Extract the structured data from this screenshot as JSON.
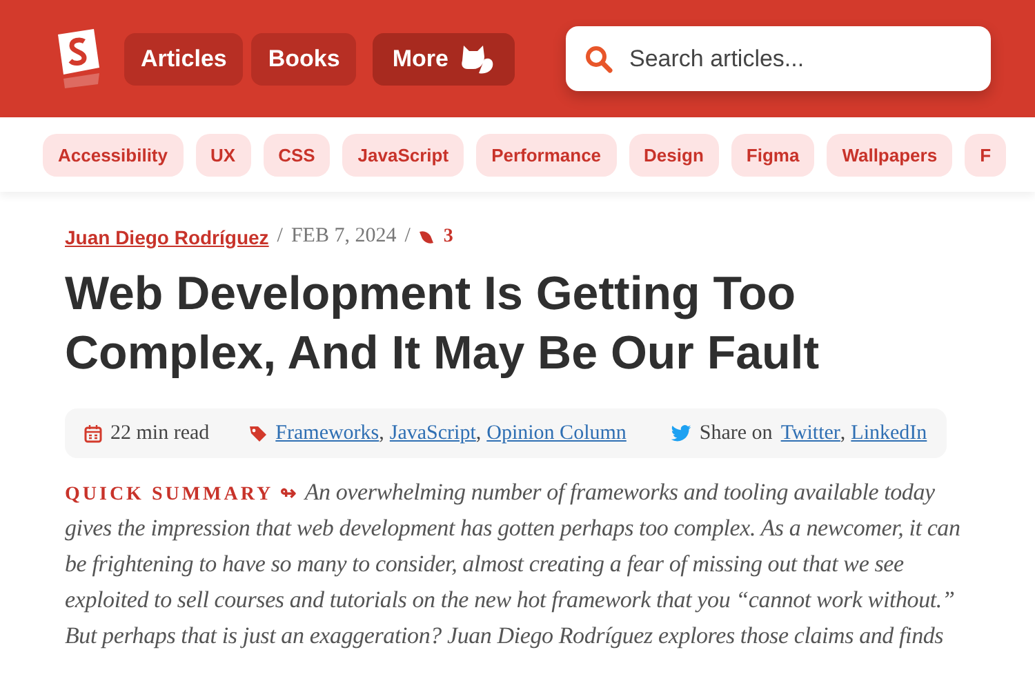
{
  "header": {
    "nav": [
      {
        "label": "Articles",
        "kind": "plain"
      },
      {
        "label": "Books",
        "kind": "plain"
      },
      {
        "label": "More",
        "kind": "mascot"
      }
    ],
    "search": {
      "placeholder": "Search articles..."
    }
  },
  "topics": [
    "Accessibility",
    "UX",
    "CSS",
    "JavaScript",
    "Performance",
    "Design",
    "Figma",
    "Wallpapers",
    "F"
  ],
  "meta": {
    "author": "Juan Diego Rodríguez",
    "separator": "/",
    "date": "FEB 7, 2024",
    "separator_2": "/",
    "comments": "3"
  },
  "title": "Web Development Is Getting Too Complex, And It May Be Our Fault",
  "info_bar": {
    "read_time": "22 min read",
    "tags": [
      "Frameworks",
      "JavaScript",
      "Opinion Column"
    ],
    "separator": ",",
    "share_label": "Share on",
    "share_links": [
      "Twitter",
      "LinkedIn"
    ]
  },
  "summary": {
    "label": "QUICK SUMMARY",
    "arrow": "↬",
    "text": "An overwhelming number of frameworks and tooling available today gives the impression that web development has gotten perhaps too complex. As a newcomer, it can be frightening to have so many to consider, almost creating a fear of missing out that we see exploited to sell courses and tutorials on the new hot framework that you “cannot work without.” But perhaps that is just an exaggeration? Juan Diego Rodríguez explores those claims and finds"
  }
}
